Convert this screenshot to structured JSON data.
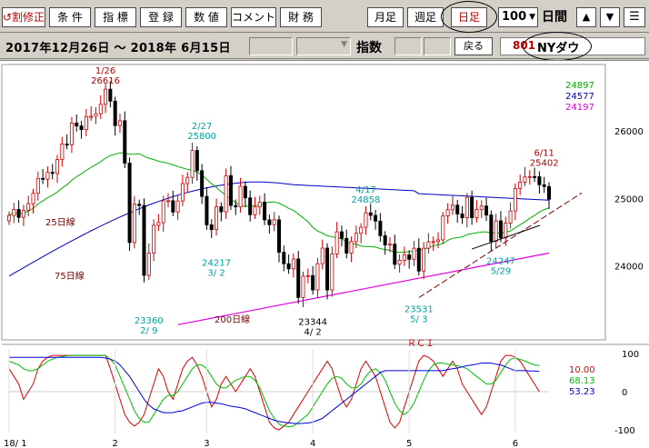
{
  "toolbar": {
    "buttons": [
      "↺割修正",
      "条 件",
      "指 標",
      "登 録",
      "数 値",
      "コメント",
      "財 務",
      "月足",
      "週足",
      "日足"
    ],
    "period_value": "100",
    "period_unit": "日間",
    "up_icon": "triangle-up-icon",
    "down_icon": "triangle-down-icon",
    "menu_icon": "menu-icon"
  },
  "info": {
    "date_range": "2017年12月26日 ～ 2018年 6月15日",
    "index_label": "指数",
    "back_label": "戻る",
    "ticker_code": "801",
    "ticker_name": "NYダウ"
  },
  "colors": {
    "ma25": "#00b000",
    "ma75": "#0000c0",
    "ma200": "#e000e0",
    "candle_up": "#d00000",
    "candle_down": "#000000",
    "rci_short": "#e00000",
    "rci_mid": "#00c000",
    "rci_long": "#0000e0",
    "annotation_high": "#b00000",
    "annotation_low": "#00a0a0",
    "trendline": "#800000"
  },
  "chart_data": {
    "type": "candlestick",
    "title": "NYダウ",
    "ylim": [
      23000,
      26900
    ],
    "yticks": [
      24000,
      25000,
      26000
    ],
    "x_labels": [
      {
        "label": "18/ 1",
        "i": 0
      },
      {
        "label": "2",
        "i": 22
      },
      {
        "label": "3",
        "i": 41
      },
      {
        "label": "4",
        "i": 63
      },
      {
        "label": "5",
        "i": 83
      },
      {
        "label": "6",
        "i": 105
      }
    ],
    "ma_current": [
      {
        "label": "24897",
        "color": "#00b000"
      },
      {
        "label": "24577",
        "color": "#0000c0"
      },
      {
        "label": "24197",
        "color": "#e000e0"
      }
    ],
    "ma_labels": [
      "25日線",
      "75日線",
      "200日線"
    ],
    "peaks": [
      {
        "date": "1/26",
        "value": "26616",
        "i": 20,
        "pos": "above",
        "color": "#b00000"
      },
      {
        "date": "2/27",
        "value": "25800",
        "i": 40,
        "pos": "above",
        "color": "#00a0a0"
      },
      {
        "date": "4/17",
        "value": "24858",
        "i": 74,
        "pos": "above",
        "color": "#00a0a0"
      },
      {
        "date": "6/11",
        "value": "25402",
        "i": 111,
        "pos": "above",
        "color": "#b00000"
      }
    ],
    "troughs": [
      {
        "date": "2/ 9",
        "value": "23360",
        "i": 29,
        "pos": "below",
        "color": "#00a0a0"
      },
      {
        "date": "3/ 2",
        "value": "24217",
        "i": 43,
        "pos": "below",
        "color": "#00a0a0"
      },
      {
        "date": "4/ 2",
        "value": "23344",
        "i": 63,
        "pos": "below",
        "color": "#000000"
      },
      {
        "date": "5/ 3",
        "value": "23531",
        "i": 85,
        "pos": "below",
        "color": "#00a0a0"
      },
      {
        "date": "5/29",
        "value": "24247",
        "i": 102,
        "pos": "below",
        "color": "#00a0a0"
      }
    ],
    "closes": [
      24746,
      24837,
      24719,
      24824,
      24922,
      25075,
      25295,
      25283,
      25385,
      25369,
      25574,
      25803,
      25792,
      26115,
      26071,
      26017,
      26210,
      26214,
      26252,
      26392,
      26616,
      26439,
      26077,
      26149,
      25521,
      24346,
      24913,
      24894,
      23860,
      24190,
      24601,
      24641,
      24965,
      24965,
      24798,
      24962,
      25219,
      25310,
      25709,
      25410,
      25029,
      24608,
      24538,
      24875,
      24801,
      25336,
      24895,
      24874,
      25178,
      25007,
      24758,
      24873,
      24946,
      24682,
      24610,
      24683,
      24202,
      24033,
      23957,
      24103,
      23533,
      23848,
      23857,
      23645,
      24033,
      24264,
      23644,
      24178,
      24505,
      24408,
      24190,
      24360,
      24483,
      24573,
      24786,
      24748,
      24664,
      24448,
      24311,
      24322,
      24024,
      24084,
      24163,
      24099,
      24262,
      23924,
      24262,
      24357,
      24360,
      24386,
      24739,
      24831,
      24899,
      24768,
      24713,
      25014,
      24715,
      24834,
      24886,
      24753,
      24361,
      24667,
      24415,
      24635,
      24813,
      25146,
      25241,
      25316,
      25322,
      25320,
      25201,
      25175,
      24987
    ],
    "rci": {
      "ylim": [
        -100,
        100
      ],
      "yticks": [
        100,
        0,
        -100
      ],
      "title": "ＲＣＩ",
      "series": [
        {
          "name": "10.00",
          "color": "#e00000",
          "values": [
            60,
            40,
            20,
            -20,
            0,
            20,
            60,
            80,
            90,
            95,
            95,
            95,
            95,
            95,
            95,
            95,
            95,
            95,
            95,
            95,
            95,
            60,
            20,
            -20,
            -60,
            -80,
            -90,
            -80,
            -60,
            -20,
            20,
            60,
            40,
            0,
            -20,
            20,
            60,
            80,
            90,
            70,
            40,
            0,
            -40,
            -20,
            20,
            40,
            20,
            0,
            20,
            40,
            60,
            40,
            0,
            -40,
            -80,
            -95,
            -100,
            -90,
            -80,
            -60,
            -40,
            -20,
            0,
            20,
            40,
            60,
            80,
            60,
            20,
            -20,
            -40,
            -20,
            20,
            60,
            80,
            60,
            40,
            0,
            -40,
            -80,
            -95,
            -80,
            -40,
            0,
            40,
            80,
            95,
            90,
            80,
            60,
            40,
            60,
            80,
            60,
            20,
            0,
            -20,
            -40,
            -60,
            -40,
            0,
            40,
            80,
            95,
            95,
            90,
            80,
            60,
            40,
            20,
            0
          ]
        },
        {
          "name": "68.13",
          "color": "#00c000",
          "values": [
            80,
            75,
            70,
            60,
            55,
            55,
            60,
            70,
            80,
            85,
            90,
            92,
            94,
            95,
            95,
            95,
            95,
            95,
            95,
            95,
            95,
            85,
            70,
            40,
            10,
            -20,
            -50,
            -70,
            -80,
            -80,
            -60,
            -40,
            -20,
            -10,
            -10,
            0,
            20,
            40,
            60,
            70,
            70,
            60,
            40,
            20,
            10,
            10,
            20,
            30,
            35,
            40,
            40,
            30,
            10,
            -20,
            -50,
            -70,
            -85,
            -90,
            -92,
            -90,
            -80,
            -70,
            -60,
            -40,
            -20,
            0,
            20,
            35,
            40,
            35,
            20,
            10,
            10,
            20,
            40,
            55,
            60,
            50,
            30,
            0,
            -30,
            -50,
            -60,
            -50,
            -30,
            0,
            30,
            55,
            70,
            75,
            75,
            72,
            70,
            68,
            65,
            60,
            50,
            40,
            30,
            20,
            20,
            30,
            50,
            70,
            85,
            88,
            85,
            80,
            75,
            70,
            68
          ]
        },
        {
          "name": "53.23",
          "color": "#0000e0",
          "values": [
            90,
            90,
            90,
            90,
            90,
            90,
            90,
            90,
            90,
            90,
            90,
            90,
            90,
            90,
            90,
            90,
            90,
            90,
            90,
            90,
            88,
            85,
            80,
            70,
            55,
            40,
            20,
            0,
            -20,
            -35,
            -45,
            -50,
            -55,
            -55,
            -55,
            -52,
            -50,
            -45,
            -40,
            -35,
            -30,
            -28,
            -28,
            -30,
            -32,
            -35,
            -38,
            -40,
            -42,
            -45,
            -50,
            -55,
            -60,
            -65,
            -70,
            -75,
            -78,
            -80,
            -82,
            -83,
            -84,
            -83,
            -82,
            -80,
            -75,
            -70,
            -60,
            -50,
            -40,
            -30,
            -20,
            -10,
            0,
            10,
            20,
            30,
            40,
            50,
            55,
            55,
            55,
            55,
            55,
            55,
            55,
            55,
            55,
            55,
            55,
            55,
            55,
            58,
            60,
            62,
            65,
            68,
            70,
            72,
            75,
            75,
            75,
            72,
            70,
            65,
            60,
            55,
            55,
            55,
            54,
            54,
            53
          ]
        }
      ]
    }
  }
}
